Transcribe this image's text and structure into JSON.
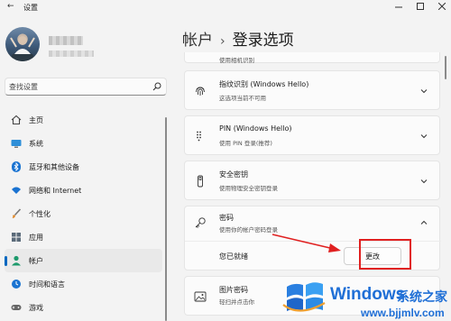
{
  "window": {
    "title": "设置",
    "controls": {
      "minimize_icon": "minimize-icon",
      "maximize_icon": "maximize-icon",
      "close_icon": "close-icon"
    }
  },
  "search": {
    "placeholder": "查找设置",
    "icon": "search-icon"
  },
  "nav": {
    "items": [
      {
        "label": "主页",
        "icon": "home-icon",
        "active": false
      },
      {
        "label": "系统",
        "icon": "system-icon",
        "active": false
      },
      {
        "label": "蓝牙和其他设备",
        "icon": "bluetooth-icon",
        "active": false
      },
      {
        "label": "网络和 Internet",
        "icon": "wifi-icon",
        "active": false
      },
      {
        "label": "个性化",
        "icon": "brush-icon",
        "active": false
      },
      {
        "label": "应用",
        "icon": "apps-icon",
        "active": false
      },
      {
        "label": "帐户",
        "icon": "account-icon",
        "active": true
      },
      {
        "label": "时间和语言",
        "icon": "globe-clock-icon",
        "active": false
      },
      {
        "label": "游戏",
        "icon": "game-icon",
        "active": false
      }
    ]
  },
  "breadcrumb": {
    "parent": "帐户",
    "separator": "›",
    "current": "登录选项"
  },
  "options": {
    "partial_top_sub": "使用相机识别",
    "fingerprint": {
      "title": "指纹识别 (Windows Hello)",
      "sub": "这选项当前不可用"
    },
    "pin": {
      "title": "PIN (Windows Hello)",
      "sub": "使用 PIN 登录(推荐)"
    },
    "security_key": {
      "title": "安全密钥",
      "sub": "使用物理安全密钥登录"
    },
    "password": {
      "title": "密码",
      "sub": "使用你的帐户密码登录",
      "status": "您已就绪",
      "change_button": "更改"
    },
    "picture_password": {
      "title": "图片密码",
      "sub": "轻扫并点击你"
    }
  },
  "colors": {
    "accent": "#0067c0",
    "annotation": "#e02020",
    "watermark": "#1f6fd6"
  },
  "watermark": {
    "brand": "Windows",
    "brand_cn": "系统之家",
    "url": "www.bjjmlv.com"
  }
}
